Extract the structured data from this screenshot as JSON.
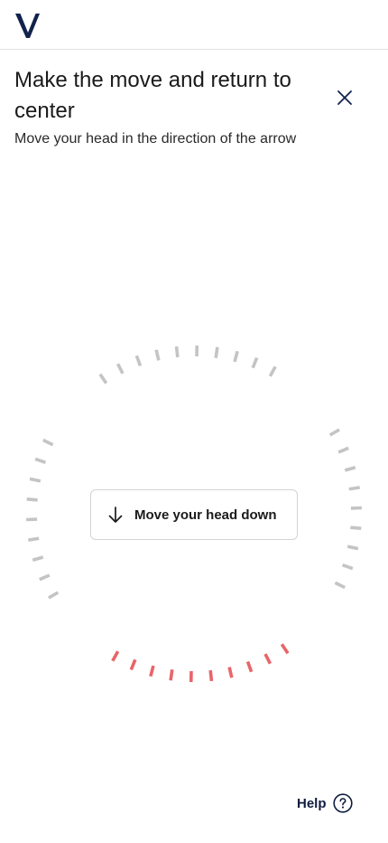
{
  "header": {
    "logo_icon": "v-logo-icon",
    "brand_color": "#12224d"
  },
  "prompt": {
    "title": "Make the move and return to center",
    "subtitle": "Move your head in the direction of the arrow",
    "close_icon": "close-icon"
  },
  "guide": {
    "instruction_label": "Move your head down",
    "arrow_icon": "arrow-down-icon",
    "tick_color_idle": "#c4c4c4",
    "tick_color_active": "#e8656a",
    "segments": [
      {
        "name": "top",
        "state": "idle"
      },
      {
        "name": "right",
        "state": "idle"
      },
      {
        "name": "bottom",
        "state": "active"
      },
      {
        "name": "left",
        "state": "idle"
      }
    ]
  },
  "footer": {
    "help_label": "Help",
    "help_icon": "question-circle-icon",
    "help_color": "#0f1c3f"
  }
}
